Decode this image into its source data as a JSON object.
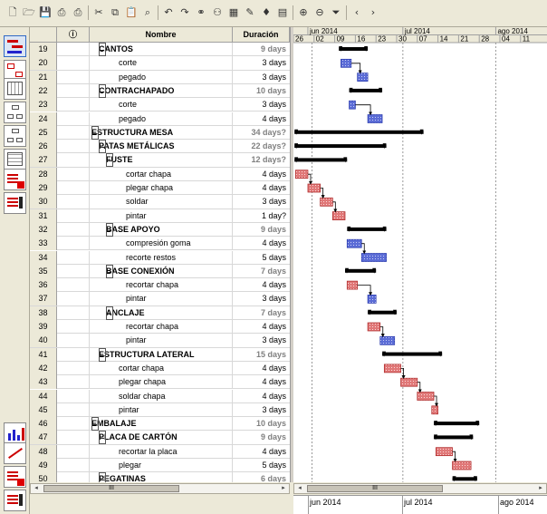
{
  "toolbar_icons": [
    "new-icon",
    "open-icon",
    "save-icon",
    "print-icon",
    "print-preview-icon",
    "cut-icon",
    "copy-icon",
    "paste-icon",
    "find-icon",
    "undo-icon",
    "redo-icon",
    "link-icon",
    "resources-icon",
    "calendar-icon",
    "notes-icon",
    "milestone-icon",
    "table-icon",
    "zoom-in-icon",
    "zoom-out-icon",
    "filter-icon",
    "scroll-left-icon",
    "scroll-right-icon"
  ],
  "grid": {
    "headers": {
      "info": "ⓘ",
      "name": "Nombre",
      "duration": "Duración"
    },
    "rows": [
      {
        "num": "19",
        "name": "CANTOS",
        "dur": "9 days",
        "level": 1,
        "summary": true,
        "greyd": true,
        "collapse": true
      },
      {
        "num": "20",
        "name": "corte",
        "dur": "3 days",
        "level": 2
      },
      {
        "num": "21",
        "name": "pegado",
        "dur": "3 days",
        "level": 2
      },
      {
        "num": "22",
        "name": "CONTRACHAPADO",
        "dur": "10 days",
        "level": 1,
        "summary": true,
        "greyd": true,
        "collapse": true
      },
      {
        "num": "23",
        "name": "corte",
        "dur": "3 days",
        "level": 2
      },
      {
        "num": "24",
        "name": "pegado",
        "dur": "4 days",
        "level": 2
      },
      {
        "num": "25",
        "name": "ESTRUCTURA MESA",
        "dur": "34 days?",
        "level": 0,
        "summary": true,
        "greyd": true,
        "collapse": true
      },
      {
        "num": "26",
        "name": "PATAS METÁLICAS",
        "dur": "22 days?",
        "level": 1,
        "summary": true,
        "greyd": true,
        "collapse": true
      },
      {
        "num": "27",
        "name": "FUSTE",
        "dur": "12 days?",
        "level": 2,
        "summary": true,
        "greyd": true,
        "collapse": true
      },
      {
        "num": "28",
        "name": "cortar chapa",
        "dur": "4 days",
        "level": 3
      },
      {
        "num": "29",
        "name": "plegar chapa",
        "dur": "4 days",
        "level": 3
      },
      {
        "num": "30",
        "name": "soldar",
        "dur": "3 days",
        "level": 3
      },
      {
        "num": "31",
        "name": "pintar",
        "dur": "1 day?",
        "level": 3
      },
      {
        "num": "32",
        "name": "BASE APOYO",
        "dur": "9 days",
        "level": 2,
        "summary": true,
        "greyd": true,
        "collapse": true
      },
      {
        "num": "33",
        "name": "compresión goma",
        "dur": "4 days",
        "level": 3
      },
      {
        "num": "34",
        "name": "recorte restos",
        "dur": "5 days",
        "level": 3
      },
      {
        "num": "35",
        "name": "BASE CONEXIÓN",
        "dur": "7 days",
        "level": 2,
        "summary": true,
        "greyd": true,
        "collapse": true
      },
      {
        "num": "36",
        "name": "recortar chapa",
        "dur": "4 days",
        "level": 3
      },
      {
        "num": "37",
        "name": "pintar",
        "dur": "3 days",
        "level": 3
      },
      {
        "num": "38",
        "name": "ANCLAJE",
        "dur": "7 days",
        "level": 2,
        "summary": true,
        "greyd": true,
        "collapse": true
      },
      {
        "num": "39",
        "name": "recortar chapa",
        "dur": "4 days",
        "level": 3
      },
      {
        "num": "40",
        "name": "pintar",
        "dur": "3 days",
        "level": 3
      },
      {
        "num": "41",
        "name": "ESTRUCTURA LATERAL",
        "dur": "15 days",
        "level": 1,
        "summary": true,
        "greyd": true,
        "collapse": true
      },
      {
        "num": "42",
        "name": "cortar chapa",
        "dur": "4 days",
        "level": 2
      },
      {
        "num": "43",
        "name": "plegar chapa",
        "dur": "4 days",
        "level": 2
      },
      {
        "num": "44",
        "name": "soldar chapa",
        "dur": "4 days",
        "level": 2
      },
      {
        "num": "45",
        "name": "pintar",
        "dur": "3 days",
        "level": 2
      },
      {
        "num": "46",
        "name": "EMBALAJE",
        "dur": "10 days",
        "level": 0,
        "summary": true,
        "greyd": true,
        "collapse": true
      },
      {
        "num": "47",
        "name": "PLACA DE CARTÓN",
        "dur": "9 days",
        "level": 1,
        "summary": true,
        "greyd": true,
        "collapse": true
      },
      {
        "num": "48",
        "name": "recortar la placa",
        "dur": "4 days",
        "level": 2
      },
      {
        "num": "49",
        "name": "plegar",
        "dur": "5 days",
        "level": 2
      },
      {
        "num": "50",
        "name": "PEGATINAS",
        "dur": "6 days",
        "level": 1,
        "summary": true,
        "greyd": true,
        "collapse": true
      }
    ]
  },
  "timescale": {
    "top": [
      {
        "label": "jun 2014"
      },
      {
        "label": "jul 2014"
      },
      {
        "label": "ago 2014"
      }
    ],
    "bottom": [
      "26",
      "02",
      "09",
      "16",
      "23",
      "30",
      "07",
      "14",
      "21",
      "28",
      "04",
      "11"
    ]
  },
  "bars": [
    {
      "row": 0,
      "type": "summary",
      "s": 2.2,
      "e": 3.6
    },
    {
      "row": 1,
      "type": "task",
      "s": 2.3,
      "e": 2.8,
      "color": "blue"
    },
    {
      "row": 2,
      "type": "task",
      "s": 3.1,
      "e": 3.6,
      "color": "blue"
    },
    {
      "row": 3,
      "type": "summary",
      "s": 2.7,
      "e": 4.3
    },
    {
      "row": 4,
      "type": "task",
      "s": 2.7,
      "e": 3.0,
      "color": "blue"
    },
    {
      "row": 5,
      "type": "task",
      "s": 3.6,
      "e": 4.3,
      "color": "blue"
    },
    {
      "row": 6,
      "type": "summary",
      "s": 0.05,
      "e": 6.3
    },
    {
      "row": 7,
      "type": "summary",
      "s": 0.05,
      "e": 4.5
    },
    {
      "row": 8,
      "type": "summary",
      "s": 0.05,
      "e": 2.6
    },
    {
      "row": 9,
      "type": "task",
      "s": 0.1,
      "e": 0.7,
      "color": "red"
    },
    {
      "row": 10,
      "type": "task",
      "s": 0.7,
      "e": 1.3,
      "color": "red"
    },
    {
      "row": 11,
      "type": "task",
      "s": 1.3,
      "e": 1.9,
      "color": "red"
    },
    {
      "row": 12,
      "type": "task",
      "s": 1.9,
      "e": 2.5,
      "color": "red"
    },
    {
      "row": 13,
      "type": "summary",
      "s": 2.6,
      "e": 4.5
    },
    {
      "row": 14,
      "type": "task",
      "s": 2.6,
      "e": 3.3,
      "color": "blue"
    },
    {
      "row": 15,
      "type": "task",
      "s": 3.3,
      "e": 4.5,
      "color": "blue"
    },
    {
      "row": 16,
      "type": "summary",
      "s": 2.5,
      "e": 4.0
    },
    {
      "row": 17,
      "type": "task",
      "s": 2.6,
      "e": 3.1,
      "color": "red"
    },
    {
      "row": 18,
      "type": "task",
      "s": 3.6,
      "e": 4.0,
      "color": "blue"
    },
    {
      "row": 19,
      "type": "summary",
      "s": 3.6,
      "e": 5.0
    },
    {
      "row": 20,
      "type": "task",
      "s": 3.6,
      "e": 4.2,
      "color": "red"
    },
    {
      "row": 21,
      "type": "task",
      "s": 4.2,
      "e": 4.9,
      "color": "blue"
    },
    {
      "row": 22,
      "type": "summary",
      "s": 4.3,
      "e": 7.2
    },
    {
      "row": 23,
      "type": "task",
      "s": 4.4,
      "e": 5.2,
      "color": "red"
    },
    {
      "row": 24,
      "type": "task",
      "s": 5.2,
      "e": 6.0,
      "color": "red"
    },
    {
      "row": 25,
      "type": "task",
      "s": 6.0,
      "e": 6.8,
      "color": "red"
    },
    {
      "row": 26,
      "type": "task",
      "s": 6.7,
      "e": 7.0,
      "color": "red"
    },
    {
      "row": 27,
      "type": "summary",
      "s": 6.8,
      "e": 9.0
    },
    {
      "row": 28,
      "type": "summary",
      "s": 6.8,
      "e": 8.7
    },
    {
      "row": 29,
      "type": "task",
      "s": 6.9,
      "e": 7.7,
      "color": "red"
    },
    {
      "row": 30,
      "type": "task",
      "s": 7.7,
      "e": 8.6,
      "color": "red"
    },
    {
      "row": 31,
      "type": "summary",
      "s": 7.7,
      "e": 8.9
    }
  ],
  "links": [
    [
      1,
      2
    ],
    [
      4,
      5
    ],
    [
      9,
      10
    ],
    [
      10,
      11
    ],
    [
      11,
      12
    ],
    [
      14,
      15
    ],
    [
      17,
      18
    ],
    [
      20,
      21
    ],
    [
      23,
      24
    ],
    [
      24,
      25
    ],
    [
      25,
      26
    ],
    [
      29,
      30
    ]
  ],
  "bottom": {
    "thumb": "III",
    "scroll_left": "◂",
    "scroll_right": "▸"
  }
}
